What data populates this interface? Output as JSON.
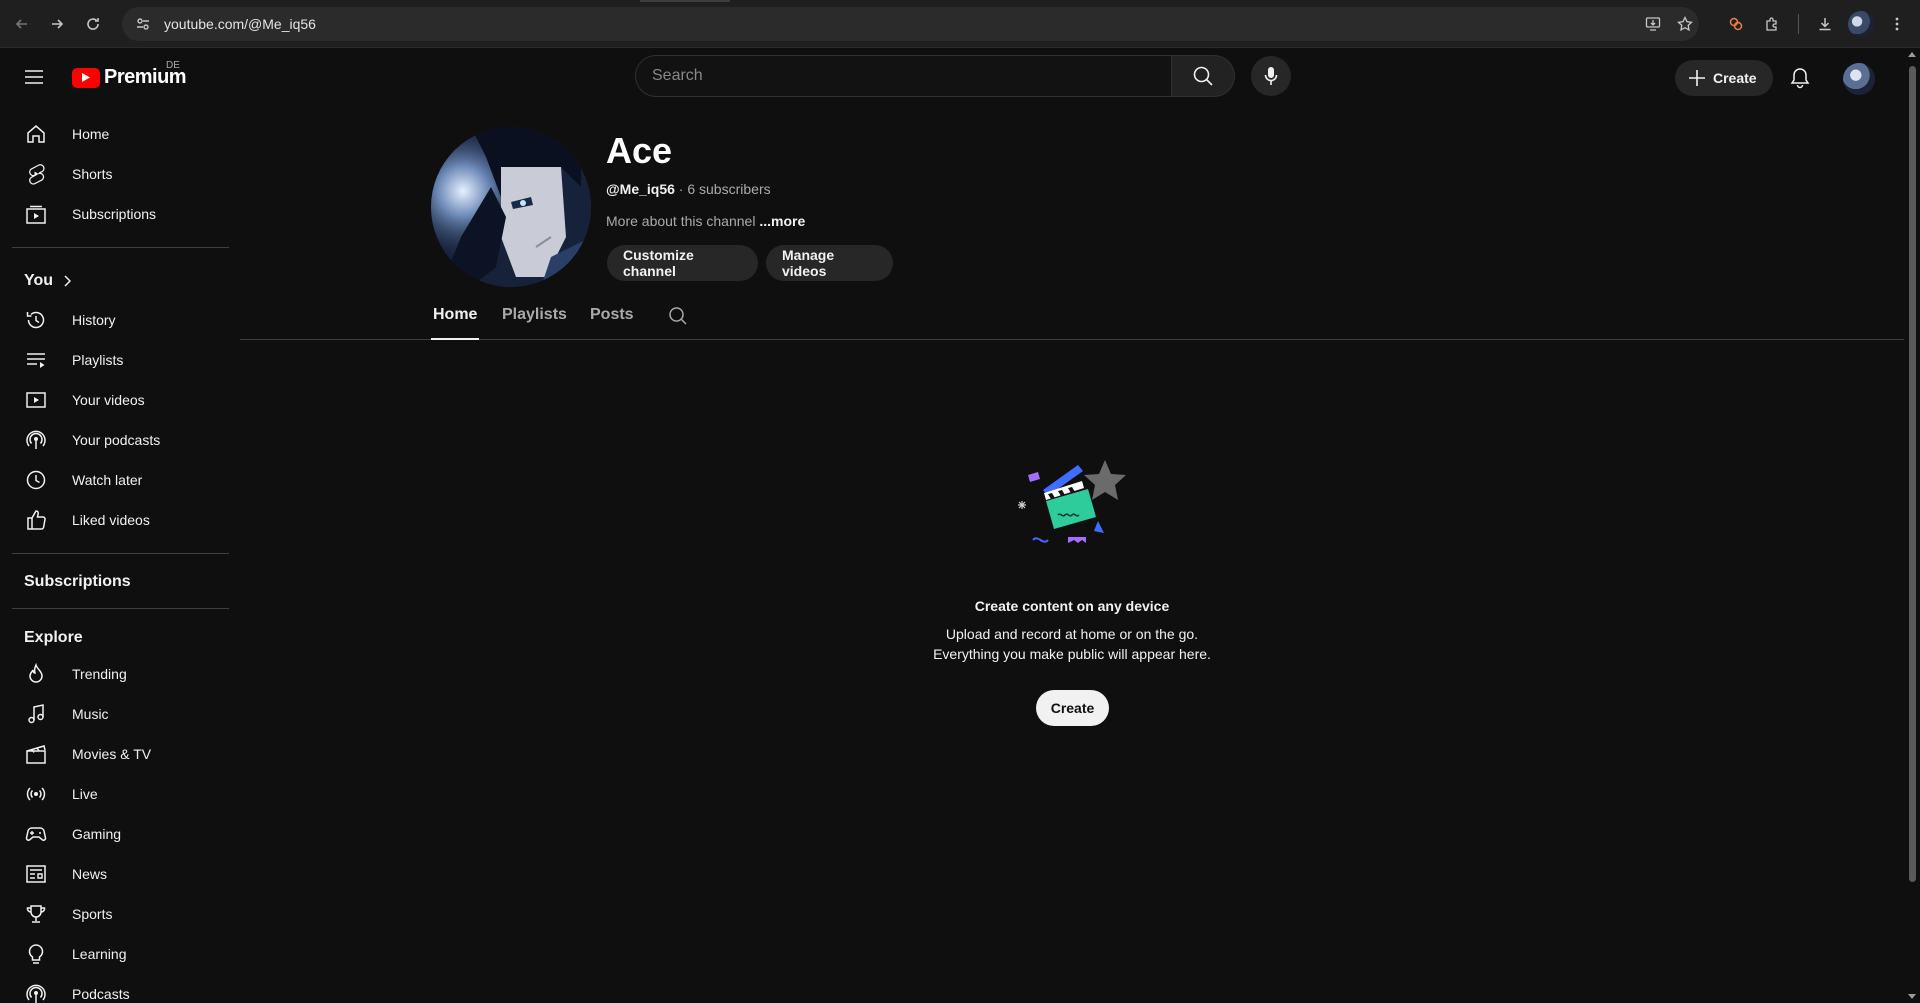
{
  "browser": {
    "url": "youtube.com/@Me_iq56",
    "icons": [
      "back-icon",
      "forward-icon",
      "reload-icon",
      "site-info-icon",
      "install-app-icon",
      "bookmark-star-icon",
      "extension-icon",
      "puzzle-icon",
      "download-icon",
      "profile-icon",
      "more-vert-icon"
    ]
  },
  "header": {
    "logo_text": "Premium",
    "country_code": "DE",
    "search_placeholder": "Search",
    "create_label": "Create"
  },
  "sidebar": {
    "primary": [
      {
        "label": "Home",
        "icon": "home-icon"
      },
      {
        "label": "Shorts",
        "icon": "shorts-icon"
      },
      {
        "label": "Subscriptions",
        "icon": "subscriptions-icon"
      }
    ],
    "you_heading": "You",
    "you_items": [
      {
        "label": "History",
        "icon": "history-icon"
      },
      {
        "label": "Playlists",
        "icon": "playlists-icon"
      },
      {
        "label": "Your videos",
        "icon": "your-videos-icon"
      },
      {
        "label": "Your podcasts",
        "icon": "podcasts-icon"
      },
      {
        "label": "Watch later",
        "icon": "clock-icon"
      },
      {
        "label": "Liked videos",
        "icon": "thumbs-up-icon"
      }
    ],
    "subscriptions_heading": "Subscriptions",
    "explore_heading": "Explore",
    "explore_items": [
      {
        "label": "Trending",
        "icon": "trending-icon"
      },
      {
        "label": "Music",
        "icon": "music-icon"
      },
      {
        "label": "Movies & TV",
        "icon": "clapperboard-icon"
      },
      {
        "label": "Live",
        "icon": "live-icon"
      },
      {
        "label": "Gaming",
        "icon": "gaming-icon"
      },
      {
        "label": "News",
        "icon": "news-icon"
      },
      {
        "label": "Sports",
        "icon": "trophy-icon"
      },
      {
        "label": "Learning",
        "icon": "lightbulb-icon"
      },
      {
        "label": "Podcasts",
        "icon": "podcasts-icon"
      }
    ]
  },
  "channel": {
    "name": "Ace",
    "handle": "@Me_iq56",
    "subscribers": "· 6 subscribers",
    "about": "More about this channel",
    "more": "...more",
    "customize_label": "Customize channel",
    "manage_label": "Manage videos",
    "tabs": [
      "Home",
      "Playlists",
      "Posts"
    ],
    "active_tab": "Home"
  },
  "empty_state": {
    "title": "Create content on any device",
    "line1": "Upload and record at home or on the go.",
    "line2": "Everything you make public will appear here.",
    "button": "Create"
  },
  "colors": {
    "background": "#0f0f0f",
    "brand_red": "#ff0000",
    "pill_bg": "#272727",
    "text": "#f1f1f1",
    "secondary_text": "#aaaaaa"
  }
}
